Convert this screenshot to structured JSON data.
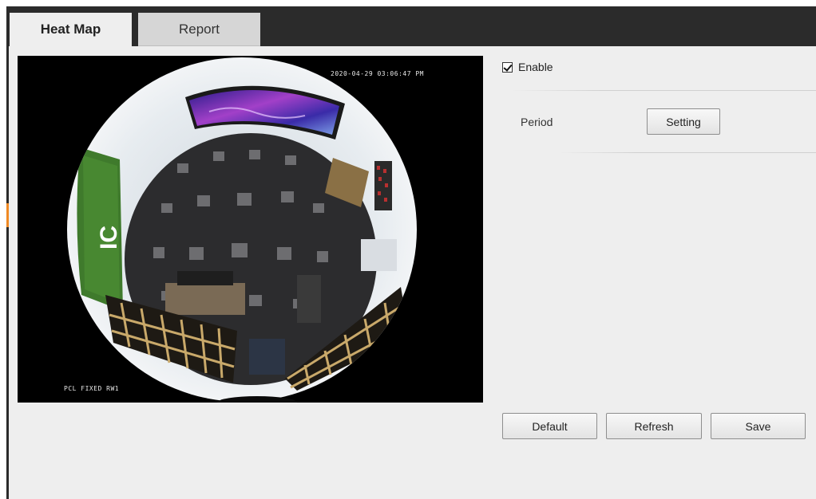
{
  "tabs": [
    {
      "label": "Heat Map",
      "active": true
    },
    {
      "label": "Report",
      "active": false
    }
  ],
  "video": {
    "osd_timestamp": "2020-04-29 03:06:47 PM",
    "osd_channel_name": "PCL FIXED RW1",
    "wall_logo_text": "IC"
  },
  "settings": {
    "enable_label": "Enable",
    "enable_checked": true,
    "period_label": "Period",
    "setting_button": "Setting"
  },
  "actions": {
    "default_button": "Default",
    "refresh_button": "Refresh",
    "save_button": "Save"
  },
  "colors": {
    "top_bar": "#2b2b2b",
    "panel_background": "#eeeeee",
    "left_accent": "#f08a24"
  }
}
